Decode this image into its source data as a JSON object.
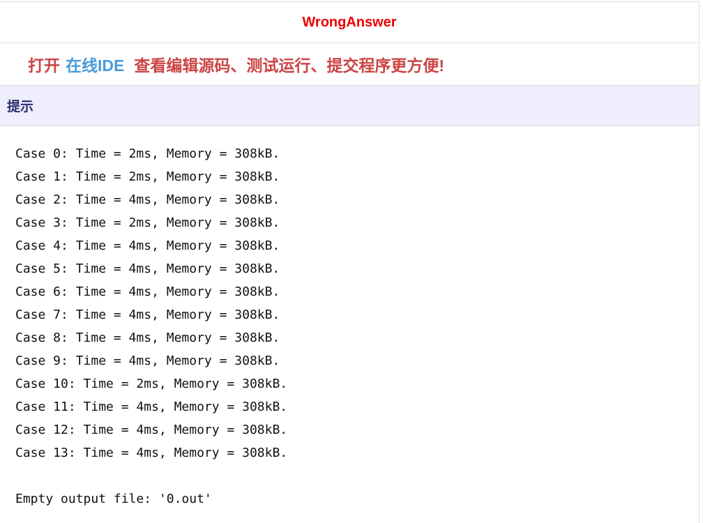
{
  "result": {
    "status": "WrongAnswer"
  },
  "promo": {
    "prefix": "打开",
    "link": "在线IDE",
    "suffix": "查看编辑源码、测试运行、提交程序更方便!"
  },
  "hint": {
    "title": "提示",
    "cases": [
      "Case 0: Time = 2ms, Memory = 308kB.",
      "Case 1: Time = 2ms, Memory = 308kB.",
      "Case 2: Time = 4ms, Memory = 308kB.",
      "Case 3: Time = 2ms, Memory = 308kB.",
      "Case 4: Time = 4ms, Memory = 308kB.",
      "Case 5: Time = 4ms, Memory = 308kB.",
      "Case 6: Time = 4ms, Memory = 308kB.",
      "Case 7: Time = 4ms, Memory = 308kB.",
      "Case 8: Time = 4ms, Memory = 308kB.",
      "Case 9: Time = 4ms, Memory = 308kB.",
      "Case 10: Time = 2ms, Memory = 308kB.",
      "Case 11: Time = 4ms, Memory = 308kB.",
      "Case 12: Time = 4ms, Memory = 308kB.",
      "Case 13: Time = 4ms, Memory = 308kB."
    ],
    "message": "Empty output file: '0.out'"
  },
  "colors": {
    "status": "#ee0000",
    "promo_text": "#cc4444",
    "ide_link": "#4a9bd8",
    "hint_bg": "#eeeefc",
    "hint_title": "#2b2f6b"
  }
}
